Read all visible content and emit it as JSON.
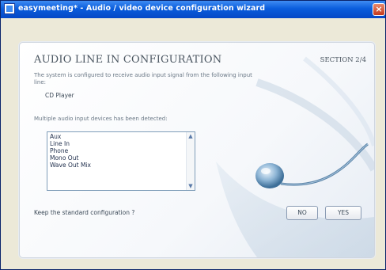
{
  "window": {
    "title": "easymeeting* - Audio / video device configuration wizard",
    "close_glyph": "×"
  },
  "panel": {
    "heading": "AUDIO LINE IN CONFIGURATION",
    "section": "SECTION 2/4",
    "description": "The system is configured to receive audio input signal from the following input line:",
    "input_line": "CD Player",
    "multiple_devices_text": "Multiple audio input devices has been detected:",
    "devices": [
      "Aux",
      "Line In",
      "Phone",
      "Mono Out",
      "Wave Out Mix"
    ],
    "question": "Keep the standard configuration ?",
    "no_button": "NO",
    "yes_button": "YES"
  },
  "icons": {
    "app": "easymeeting-app-icon",
    "microphone": "microphone-illustration",
    "scroll_up": "scroll-up-arrow-icon",
    "scroll_down": "scroll-down-arrow-icon"
  },
  "colors": {
    "titlebar": "#0a5ddc",
    "panel_bg": "#ffffff",
    "heading_text": "#4a5560",
    "list_border": "#7f9db9"
  }
}
